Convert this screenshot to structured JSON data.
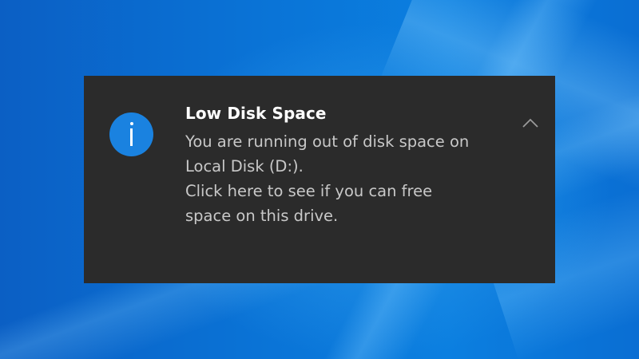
{
  "toast": {
    "icon": "info-icon",
    "title": "Low Disk Space",
    "message_lines": [
      "You are running out of disk space on",
      "Local Disk (D:)."
    ],
    "action_lines": [
      "Click here to see if you can free",
      "space on this drive."
    ],
    "collapse_icon": "chevron-up-icon"
  },
  "colors": {
    "toast_background": "#2b2b2b",
    "icon_accent": "#1a82e0",
    "title_text": "#ffffff",
    "body_text": "#c8c8c8",
    "desktop_background": "#0a73d6"
  }
}
